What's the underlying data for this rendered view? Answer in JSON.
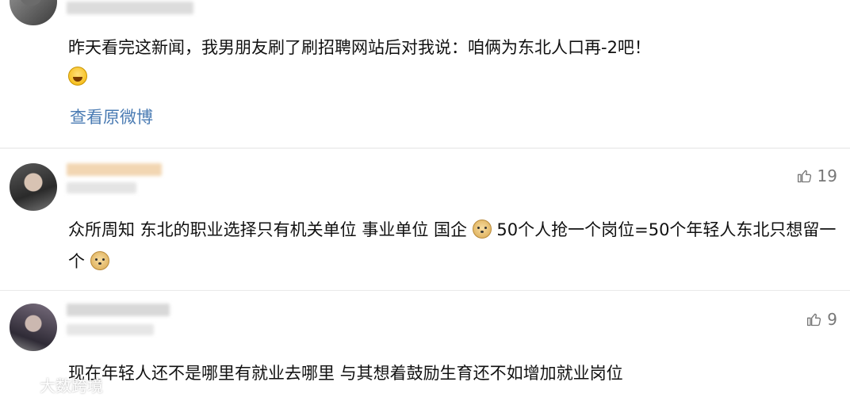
{
  "post": {
    "text": "昨天看完这新闻，我男朋友刷了刷招聘网站后对我说：咱俩为东北人口再-2吧！",
    "emoji": "laugh-cry-emoji",
    "view_original": "查看原微博"
  },
  "comments": [
    {
      "text": "众所周知 东北的职业选择只有机关单位 事业单位 国企",
      "text_b": " 50个人抢一个岗位=50个年轻人东北只想留一个",
      "likes": "19"
    },
    {
      "text": "现在年轻人还不是哪里有就业去哪里 与其想着鼓励生育还不如增加就业岗位",
      "likes": "9"
    }
  ],
  "watermark": {
    "text": "大数跨境"
  },
  "colors": {
    "link": "#4a7bb3",
    "like": "#777777",
    "background": "#f7f7f7"
  }
}
